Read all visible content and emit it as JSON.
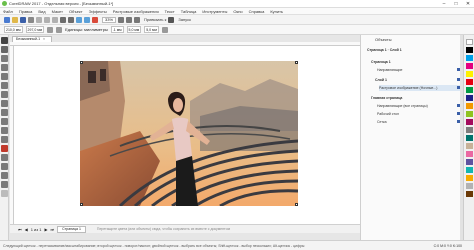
{
  "window": {
    "title": "CorelDRAW 2017 - Отдельная версия - [Безымянный-1*]",
    "minimize_label": "–",
    "maximize_label": "□",
    "close_label": "✕"
  },
  "menu": {
    "items": [
      "Файл",
      "Правка",
      "Вид",
      "Макет",
      "Объект",
      "Эффекты",
      "Растровые изображения",
      "Текст",
      "Таблица",
      "Инструменты",
      "Окно",
      "Справка",
      "Купить"
    ]
  },
  "toolbar": {
    "zoom_value": "33%",
    "launch_label": "Привязать к",
    "mode_label": "Запуск"
  },
  "propertybar": {
    "width": "210,0 мм",
    "height": "297,0 мм",
    "units": "Единицы: миллиметры",
    "nudge": ".1 мм",
    "dup_x": "5,0 мм",
    "dup_y": "5,0 мм"
  },
  "document": {
    "tab_label": "Безымянный-1",
    "tab_close": "×"
  },
  "pagebar": {
    "position": "1 из 1",
    "page_tab": "Страница 1",
    "hint": "Перетащите цвета (или объекты) сюда, чтобы сохранить их вместе с документом"
  },
  "status": {
    "left": "Следующий щелчок - перетаскивание/масштабирование; второй щелчок - поворот/наклон; двойной щелчок - выбрать все объекты; Shift-щелчок - выбор нескольких; Alt-щелчок - цифры",
    "right": "C:0 M:0 Y:0 K:100"
  },
  "objects_panel": {
    "title": "Объекты",
    "page_label": "Страница 1",
    "layer_label": "Слой 1",
    "master": "Главная страница",
    "rows": [
      "Страница 1",
      "Направляющие",
      "Слой 1",
      "Растровое изображение (Ночные...)",
      "Главная страница",
      "Направляющие (все страницы)",
      "Рабочий стол",
      "Сетка"
    ]
  },
  "palette_colors": [
    "#ffffff",
    "#000000",
    "#00a0e9",
    "#e4007f",
    "#fff100",
    "#e60012",
    "#009944",
    "#1d2088",
    "#f39800",
    "#8fc31f",
    "#a40b5d",
    "#7d7d7d",
    "#00736d",
    "#c7b299",
    "#ea68a2",
    "#5f52a0",
    "#13b5b1",
    "#f7ab00",
    "#b3b3b3",
    "#6a3906"
  ],
  "accent": "#3a5fa8"
}
